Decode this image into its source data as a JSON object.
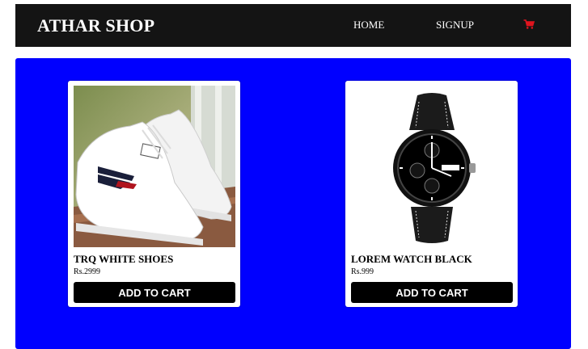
{
  "header": {
    "brand": "ATHAR SHOP",
    "nav": {
      "home": "HOME",
      "signup": "SIGNUP"
    },
    "cart_icon": "shopping-cart-icon",
    "cart_icon_color": "#e0141e"
  },
  "colors": {
    "navbar_bg": "#141414",
    "main_bg": "#0000ff",
    "button_bg": "#000000"
  },
  "products": [
    {
      "name": "TRQ WHITE SHOES",
      "price": "Rs.2999",
      "button": "ADD TO CART",
      "image": "white-sneakers-image"
    },
    {
      "name": "LOREM WATCH BLACK",
      "price": "Rs.999",
      "button": "ADD TO CART",
      "image": "black-chronograph-watch-image"
    }
  ]
}
